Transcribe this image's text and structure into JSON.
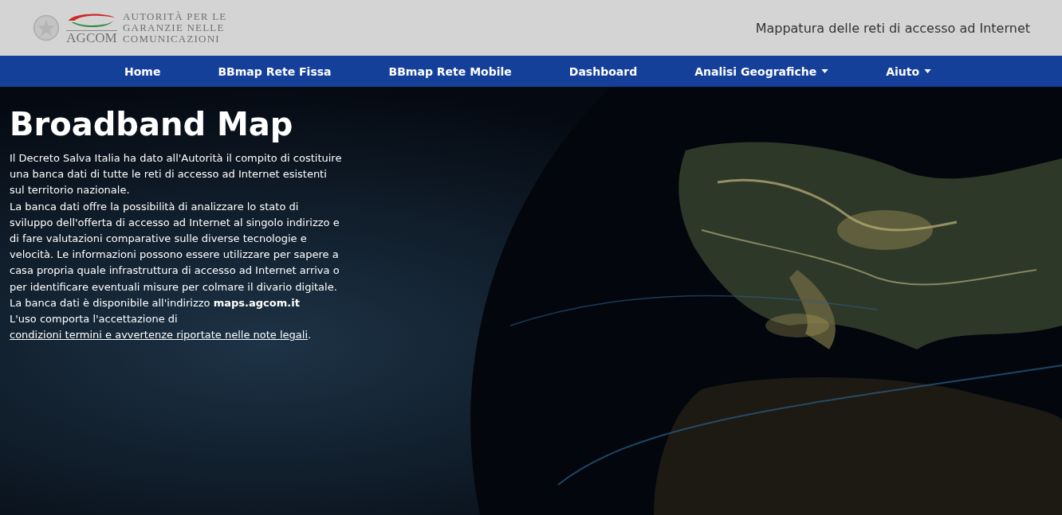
{
  "header": {
    "logo": {
      "acronym": "AGCOM",
      "name_lines": [
        "AUTORITÀ PER LE",
        "GARANZIE NELLE",
        "COMUNICAZIONI"
      ]
    },
    "site_title": "Mappatura delle reti di accesso ad Internet"
  },
  "nav": [
    {
      "label": "Home",
      "dropdown": false
    },
    {
      "label": "BBmap Rete Fissa",
      "dropdown": false
    },
    {
      "label": "BBmap Rete Mobile",
      "dropdown": false
    },
    {
      "label": "Dashboard",
      "dropdown": false
    },
    {
      "label": "Analisi Geografiche",
      "dropdown": true
    },
    {
      "label": "Aiuto",
      "dropdown": true
    }
  ],
  "hero": {
    "kind": "picture",
    "heading": "Broadband Map",
    "paragraphs": [
      {
        "text": "Il Decreto Salva Italia ha dato all'Autorità il compito di costituire una banca dati di tutte le reti di accesso ad Internet esistenti sul territorio nazionale."
      },
      {
        "text": "La banca dati offre la possibilità di analizzare lo stato di sviluppo dell'offerta di accesso ad Internet al singolo indirizzo e di fare valutazioni comparative sulle diverse tecnologie e velocità. Le informazioni possono essere utilizzare per sapere a casa propria quale infrastruttura di accesso ad Internet arriva o per identificare eventuali misure per colmare il divario digitale."
      },
      {
        "text": "La banca dati è disponibile all'indirizzo **maps.agcom.it**"
      },
      {
        "text": "L'uso comporta l'accettazione di",
        "link": "condizioni termini e avvertenze riportate nelle note legali",
        "after": "."
      }
    ]
  }
}
